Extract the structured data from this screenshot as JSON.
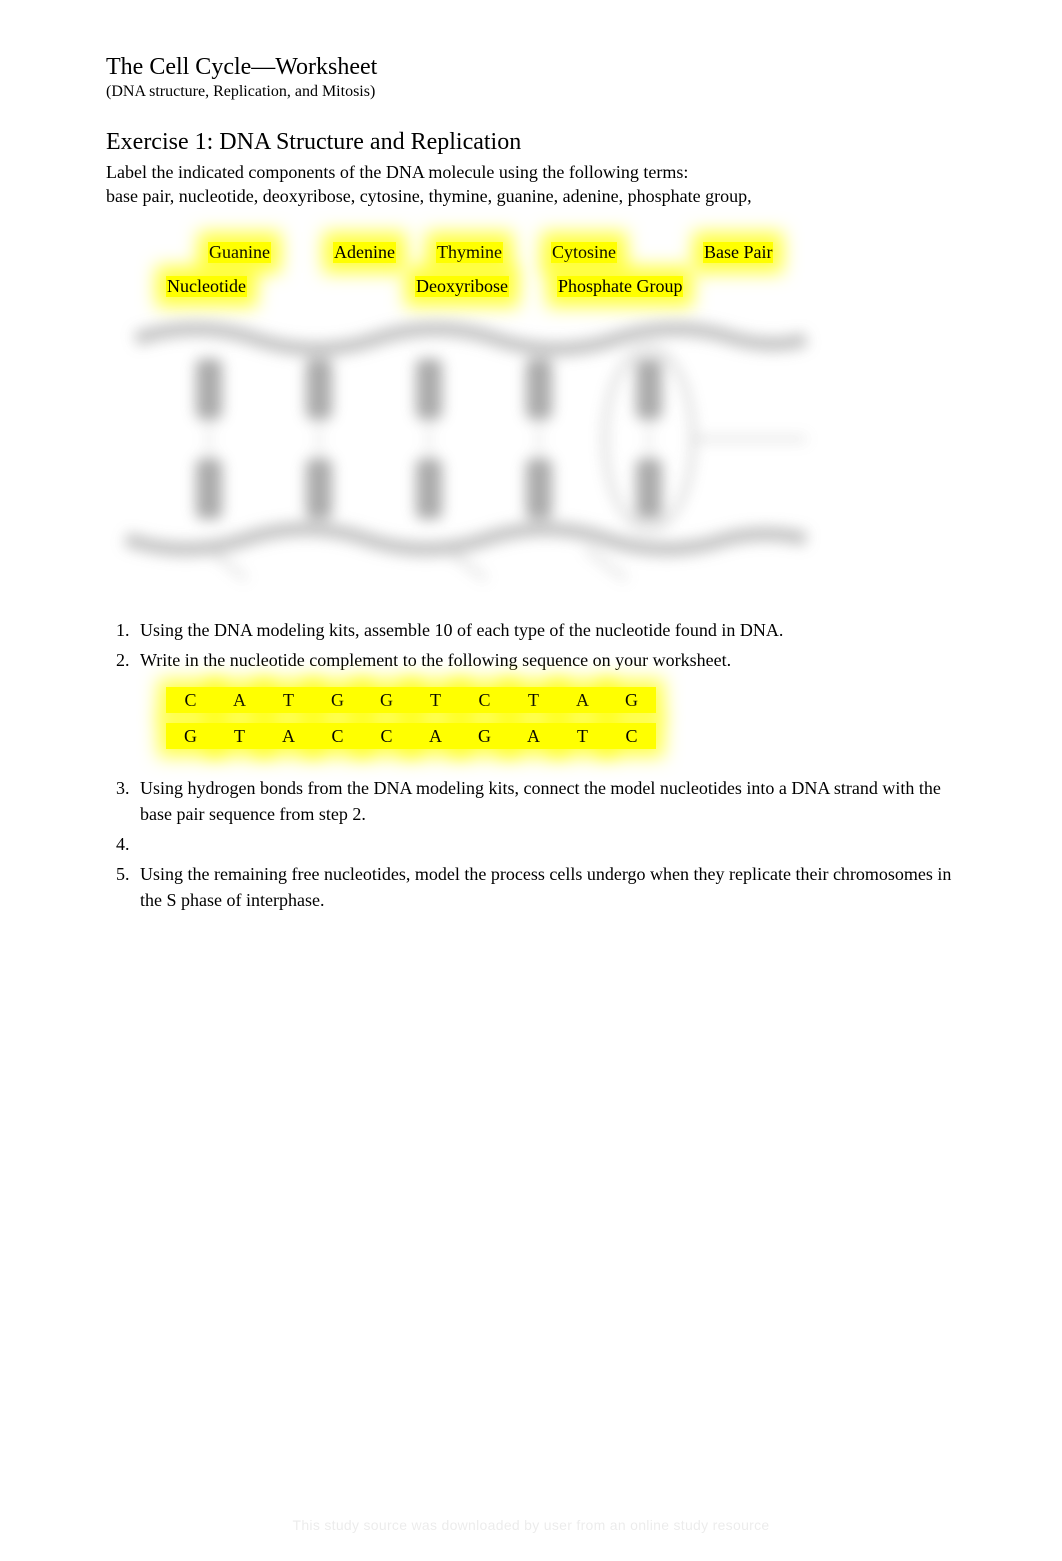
{
  "header": {
    "title": "The Cell Cycle—Worksheet",
    "subtitle": "(DNA structure, Replication, and Mitosis)"
  },
  "exercise": {
    "heading": "Exercise 1: DNA Structure and Replication",
    "instructions_line1": "Label the indicated components of the DNA molecule using the following terms:",
    "instructions_line2": "base pair, nucleotide, deoxyribose, cytosine, thymine, guanine, adenine, phosphate group,"
  },
  "labels": {
    "row1": {
      "guanine": "Guanine",
      "adenine": "Adenine",
      "thymine": "Thymine",
      "cytosine": "Cytosine",
      "basepair": "Base Pair"
    },
    "row2": {
      "nucleotide": "Nucleotide",
      "deoxyribose": "Deoxyribose",
      "phosphate": "Phosphate Group"
    }
  },
  "list": {
    "item1": "Using the DNA modeling kits, assemble 10 of each type of the nucleotide found in DNA.",
    "item2": "Write in the nucleotide complement to the following sequence on your worksheet.",
    "item3": "Using hydrogen bonds from the DNA modeling kits, connect the model nucleotides into a DNA strand with the base pair sequence from step 2.",
    "item4": "",
    "item5": "Using the remaining free nucleotides, model the process cells undergo when they replicate their chromosomes in the S phase of interphase."
  },
  "sequence": {
    "top": [
      "C",
      "A",
      "T",
      "G",
      "G",
      "T",
      "C",
      "T",
      "A",
      "G"
    ],
    "bottom": [
      "G",
      "T",
      "A",
      "C",
      "C",
      "A",
      "G",
      "A",
      "T",
      "C"
    ]
  },
  "watermark": "This study source was downloaded by user from an online study resource"
}
